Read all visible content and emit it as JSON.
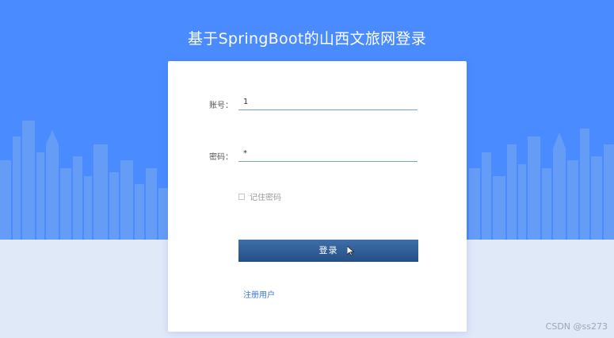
{
  "page": {
    "title": "基于SpringBoot的山西文旅网登录"
  },
  "form": {
    "account_label": "账号：",
    "account_value": "1",
    "password_label": "密码：",
    "password_value": "*",
    "remember_label": "记住密码",
    "remember_checked": false,
    "login_label": "登录",
    "register_label": "注册用户"
  },
  "watermark": "CSDN @ss273",
  "colors": {
    "sky": "#4a8bff",
    "skyline": "#6a9ff2",
    "ground": "#dfe9f8",
    "button": "#2b5a92",
    "link": "#3a78d4"
  },
  "icons": [
    "cursor-arrow-icon"
  ]
}
